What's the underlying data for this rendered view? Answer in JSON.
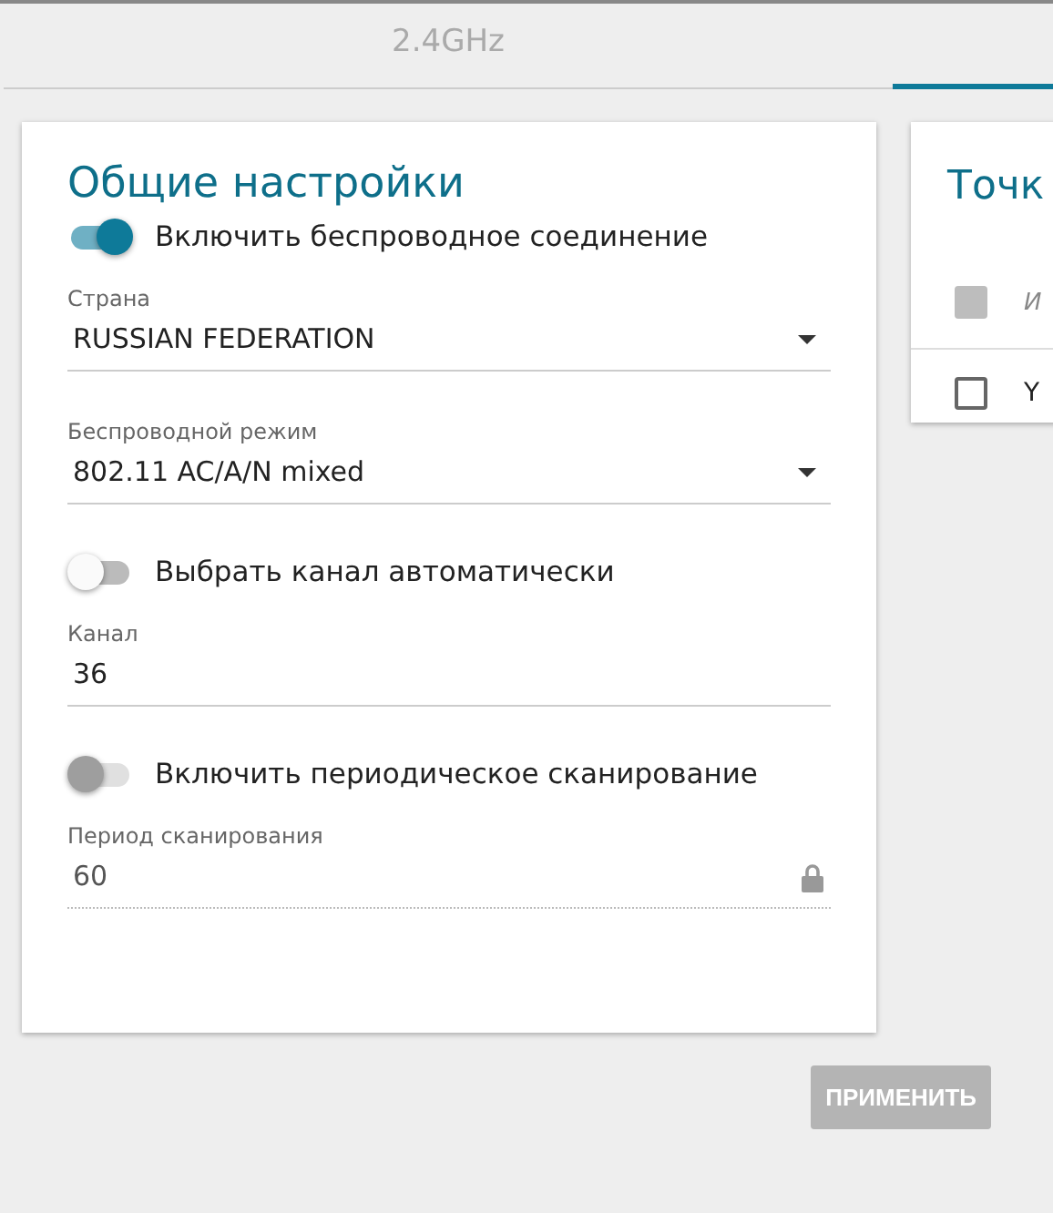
{
  "tabs": [
    {
      "label": "2.4GHz",
      "selected": false
    },
    {
      "selected": true
    }
  ],
  "general": {
    "title": "Общие настройки",
    "items": [
      {
        "kind": "toggle",
        "label": "Включить беспроводное соединение",
        "on": true,
        "disabled": false
      },
      {
        "kind": "select",
        "label": "Страна",
        "value": "RUSSIAN FEDERATION",
        "disabled": false
      },
      {
        "kind": "select",
        "label": "Беспроводной режим",
        "value": "802.11 AC/A/N mixed",
        "disabled": false
      },
      {
        "kind": "toggle",
        "label": "Выбрать канал автоматически",
        "on": false,
        "disabled": false
      },
      {
        "kind": "text",
        "label": "Канал",
        "value": "36",
        "disabled": false
      },
      {
        "kind": "toggle",
        "label": "Включить периодическое сканирование",
        "on": false,
        "disabled": true
      },
      {
        "kind": "text",
        "label": "Период сканирования",
        "value": "60",
        "disabled": true
      }
    ]
  },
  "access_points": {
    "title": "Точк",
    "header": {
      "checked": false,
      "disabled": true,
      "column_1": "И"
    },
    "rows": [
      {
        "checked": false,
        "column_1": "Y"
      }
    ]
  },
  "apply_button": {
    "label": "ПРИМЕНИТЬ",
    "disabled": true
  }
}
